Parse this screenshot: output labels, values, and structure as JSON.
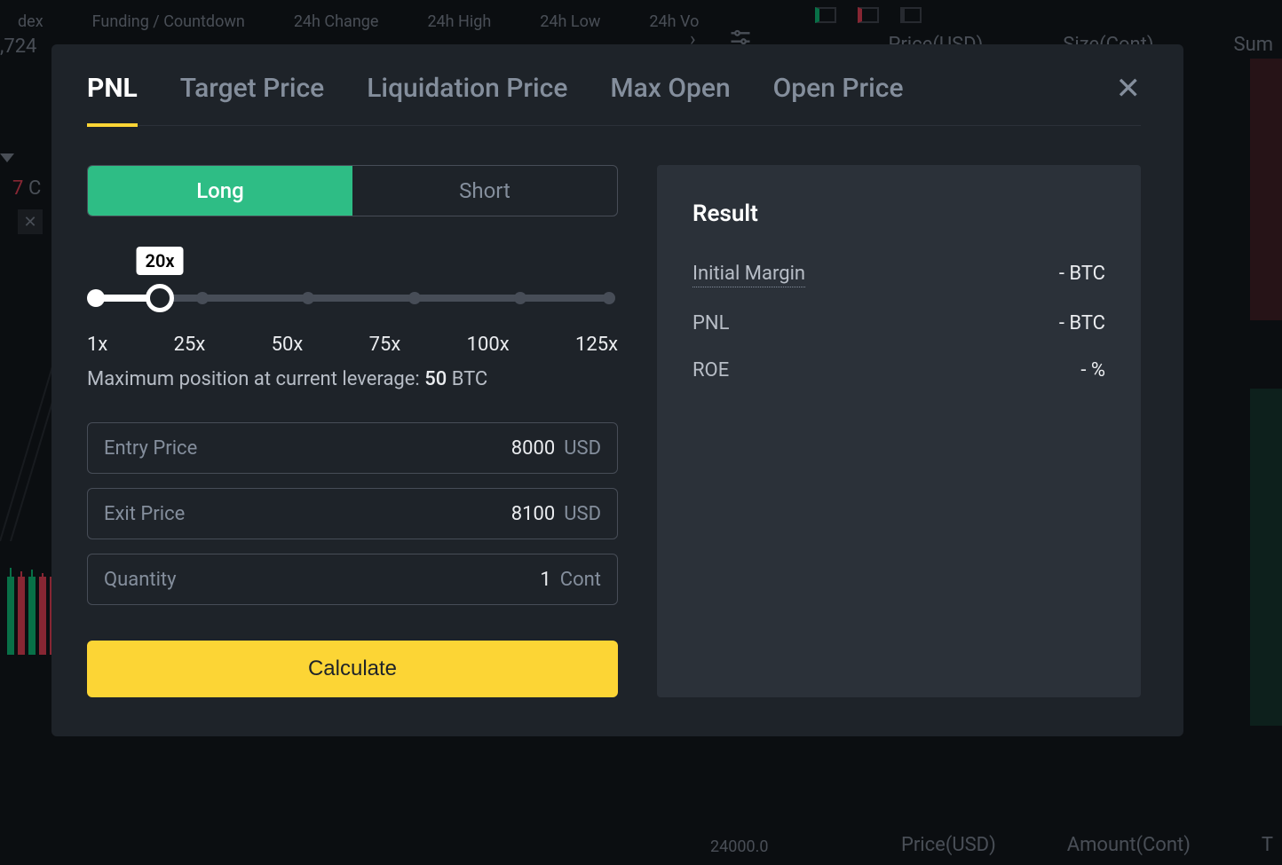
{
  "background": {
    "header_items": [
      "dex",
      "Funding / Countdown",
      "24h Change",
      "24h High",
      "24h Low",
      "24h Vo"
    ],
    "price_fragment": ",724",
    "right_header": {
      "price": "Price(USD)",
      "size": "Size(Cont)",
      "sum": "Sum"
    },
    "bottom_right": {
      "price": "Price(USD)",
      "amount": "Amount(Cont)",
      "t": "T"
    },
    "bottom_tick": "24000.0",
    "left_7": "7",
    "left_c": "C"
  },
  "modal": {
    "tabs": {
      "pnl": "PNL",
      "target_price": "Target Price",
      "liquidation_price": "Liquidation Price",
      "max_open": "Max Open",
      "open_price": "Open Price"
    },
    "position": {
      "long": "Long",
      "short": "Short"
    },
    "leverage": {
      "tooltip": "20x",
      "ticks": [
        "1x",
        "25x",
        "50x",
        "75x",
        "100x",
        "125x"
      ],
      "max_label_prefix": "Maximum position at current leverage: ",
      "max_value": "50",
      "max_unit": " BTC"
    },
    "fields": {
      "entry": {
        "label": "Entry Price",
        "value": "8000",
        "unit": "USD"
      },
      "exit": {
        "label": "Exit Price",
        "value": "8100",
        "unit": "USD"
      },
      "qty": {
        "label": "Quantity",
        "value": "1",
        "unit": "Cont"
      }
    },
    "calculate": "Calculate",
    "result": {
      "title": "Result",
      "rows": {
        "margin": {
          "label": "Initial Margin",
          "value": "- BTC"
        },
        "pnl": {
          "label": "PNL",
          "value": "- BTC"
        },
        "roe": {
          "label": "ROE",
          "value": "- %"
        }
      }
    }
  }
}
